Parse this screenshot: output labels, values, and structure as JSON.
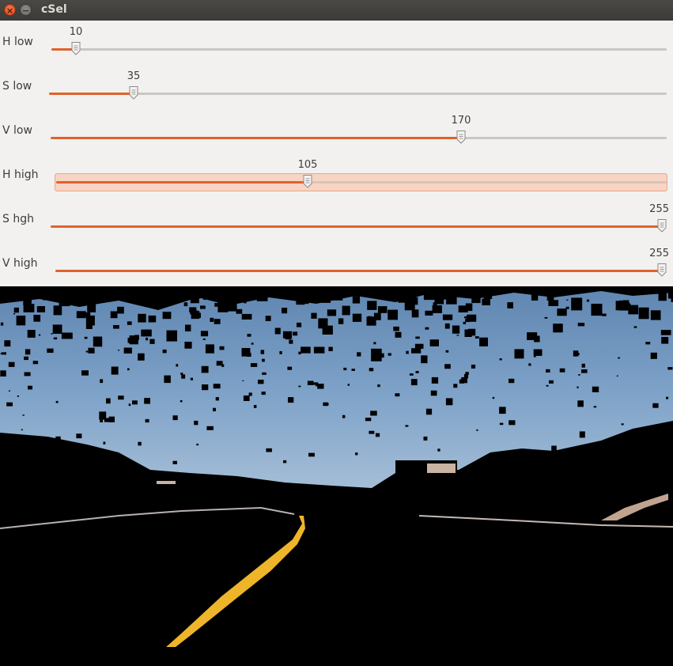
{
  "window": {
    "title": "cSel"
  },
  "sliders": [
    {
      "label": "H low",
      "value": 10,
      "max": 255
    },
    {
      "label": "S low",
      "value": 35,
      "max": 255
    },
    {
      "label": "V low",
      "value": 170,
      "max": 255
    },
    {
      "label": "H high",
      "value": 105,
      "max": 255
    },
    {
      "label": "S hgh",
      "value": 255,
      "max": 255
    },
    {
      "label": "V high",
      "value": 255,
      "max": 255
    }
  ],
  "colors": {
    "accent": "#e0622b",
    "sky_top": "#5f86b1",
    "sky_bottom": "#a9c3dc",
    "lane_line": "#f1b829",
    "masked": "#000000"
  }
}
